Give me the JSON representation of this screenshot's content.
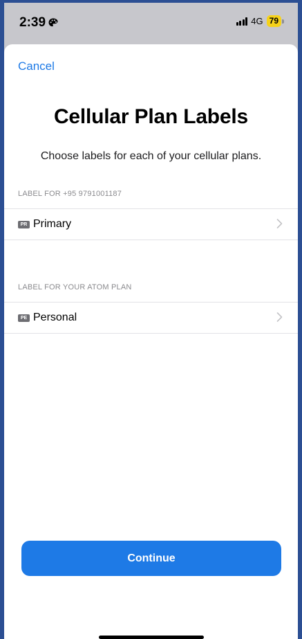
{
  "status_bar": {
    "time": "2:39",
    "network": "4G",
    "battery_level": "79",
    "battery_color": "#f6d21a",
    "icons": [
      "palette-icon",
      "signal-icon",
      "battery-icon"
    ]
  },
  "sheet": {
    "cancel_label": "Cancel",
    "title": "Cellular Plan Labels",
    "subtitle": "Choose labels for each of your cellular plans."
  },
  "plans": [
    {
      "header": "LABEL FOR +95 9791001187",
      "badge": "PR",
      "label": "Primary"
    },
    {
      "header": "LABEL FOR YOUR ATOM PLAN",
      "badge": "PE",
      "label": "Personal"
    }
  ],
  "continue_label": "Continue",
  "colors": {
    "accent": "#1e7ae6",
    "outer_background": "#2c4f93",
    "status_bar_background": "#c7c7cc"
  }
}
